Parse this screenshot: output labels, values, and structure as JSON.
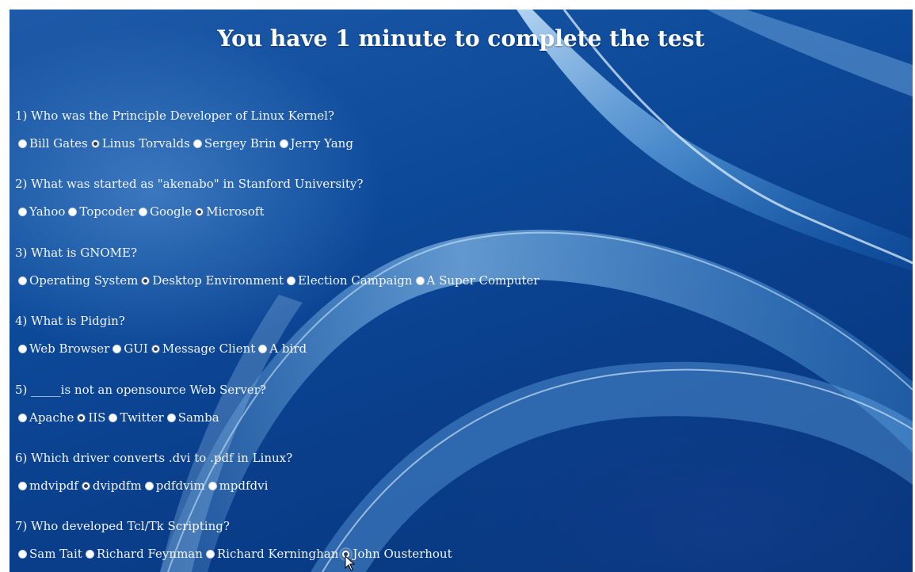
{
  "page": {
    "title": "You have 1 minute to complete the test"
  },
  "questions": [
    {
      "text": "1) Who was the Principle Developer of Linux Kernel?",
      "options": [
        {
          "label": "Bill Gates",
          "selected": false
        },
        {
          "label": "Linus Torvalds",
          "selected": true
        },
        {
          "label": "Sergey Brin",
          "selected": false
        },
        {
          "label": "Jerry Yang",
          "selected": false
        }
      ]
    },
    {
      "text": "2) What was started as \"akenabo\" in Stanford University?",
      "options": [
        {
          "label": "Yahoo",
          "selected": false
        },
        {
          "label": "Topcoder",
          "selected": false
        },
        {
          "label": "Google",
          "selected": false
        },
        {
          "label": "Microsoft",
          "selected": true
        }
      ]
    },
    {
      "text": "3) What is GNOME?",
      "options": [
        {
          "label": "Operating System",
          "selected": false
        },
        {
          "label": "Desktop Environment",
          "selected": true
        },
        {
          "label": "Election Campaign",
          "selected": false
        },
        {
          "label": "A Super Computer",
          "selected": false
        }
      ]
    },
    {
      "text": "4) What is Pidgin?",
      "options": [
        {
          "label": "Web Browser",
          "selected": false
        },
        {
          "label": "GUI",
          "selected": false
        },
        {
          "label": "Message Client",
          "selected": true
        },
        {
          "label": "A bird",
          "selected": false
        }
      ]
    },
    {
      "text": "5) _____is not an opensource Web Server?",
      "options": [
        {
          "label": "Apache",
          "selected": false
        },
        {
          "label": "IIS",
          "selected": true
        },
        {
          "label": "Twitter",
          "selected": false
        },
        {
          "label": "Samba",
          "selected": false
        }
      ]
    },
    {
      "text": "6) Which driver converts .dvi to .pdf in Linux?",
      "options": [
        {
          "label": "mdvipdf",
          "selected": false
        },
        {
          "label": "dvipdfm",
          "selected": true
        },
        {
          "label": "pdfdvim",
          "selected": false
        },
        {
          "label": "mpdfdvi",
          "selected": false
        }
      ]
    },
    {
      "text": "7) Who developed Tcl/Tk Scripting?",
      "options": [
        {
          "label": "Sam Tait",
          "selected": false
        },
        {
          "label": "Richard Feynman",
          "selected": false
        },
        {
          "label": "Richard Kerninghan",
          "selected": false
        },
        {
          "label": "John Ousterhout",
          "selected": true,
          "focused": true
        }
      ]
    }
  ],
  "icons": {
    "cursor": "arrow-cursor-icon",
    "radio": "radio-button-icon"
  },
  "colors": {
    "background_top": "#1e5aa8",
    "background_bottom": "#07357a",
    "text": "#f3f6fa"
  }
}
